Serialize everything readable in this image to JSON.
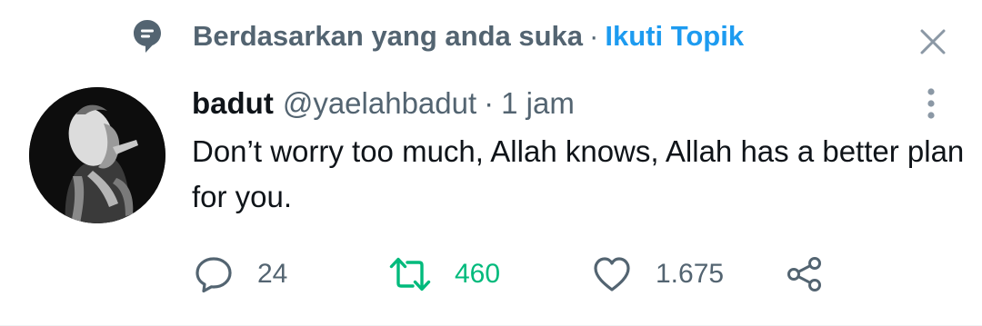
{
  "context": {
    "text": "Berdasarkan yang anda suka",
    "separator": "·",
    "follow_label": "Ikuti Topik",
    "icon": "topic-bubble-icon"
  },
  "tweet": {
    "display_name": "badut",
    "handle": "@yaelahbadut",
    "separator": "·",
    "time": "1 jam",
    "text": "Don’t worry too much, Allah knows, Allah has a better plan for you."
  },
  "actions": {
    "replies": "24",
    "retweets": "460",
    "likes": "1.675"
  },
  "colors": {
    "accent_blue": "#1d9bf0",
    "retweet_green": "#00ba7c",
    "secondary_text": "#536471",
    "primary_text": "#0f1419"
  }
}
